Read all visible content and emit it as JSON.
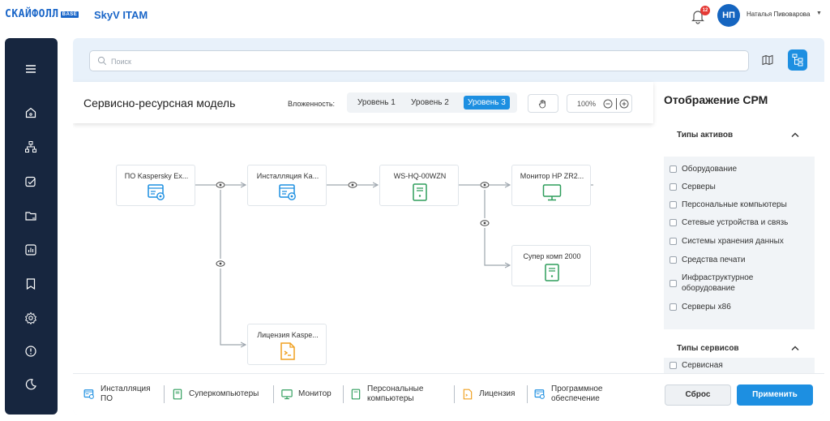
{
  "header": {
    "logo_text": "СКАЙФОЛЛ",
    "logo_badge": "BASE",
    "app_name": "SkyV ITAM",
    "notifications_count": "12",
    "avatar_initials": "НП",
    "user_name": "Наталья Пивоварова"
  },
  "sidebar": {
    "items": [
      "menu-icon",
      "home-icon",
      "structure-icon",
      "checklist-icon",
      "folder-icon",
      "report-icon",
      "bookmark-icon",
      "settings-icon",
      "info-icon",
      "moon-icon"
    ]
  },
  "search": {
    "placeholder": "Поиск"
  },
  "canvas": {
    "title": "Сервисно-ресурсная модель",
    "nesting_label": "Вложенность:",
    "levels": [
      "Уровень 1",
      "Уровень 2",
      "Уровень 3"
    ],
    "active_level": "Уровень 3",
    "zoom": "100%"
  },
  "nodes": [
    {
      "label": "ПО Kaspersky Ex...",
      "icon": "software-icon",
      "color": "#1d8fe1"
    },
    {
      "label": "Инсталляция Ka...",
      "icon": "installation-icon",
      "color": "#1d8fe1"
    },
    {
      "label": "WS-HQ-00WZN",
      "icon": "supercomputer-icon",
      "color": "#2e9d5b"
    },
    {
      "label": "Монитор HP ZR2...",
      "icon": "monitor-icon",
      "color": "#2e9d5b"
    },
    {
      "label": "Супер комп 2000",
      "icon": "supercomputer-icon",
      "color": "#2e9d5b"
    },
    {
      "label": "Лицензия Kaspe...",
      "icon": "license-icon",
      "color": "#f0a020"
    }
  ],
  "legend": [
    {
      "label": "Инсталляция\nПО",
      "icon": "installation-icon"
    },
    {
      "label": "Суперкомпьютеры",
      "icon": "supercomputer-icon"
    },
    {
      "label": "Монитор",
      "icon": "monitor-icon"
    },
    {
      "label": "Персональные\nкомпьютеры",
      "icon": "pc-icon"
    },
    {
      "label": "Лицензия",
      "icon": "license-icon"
    },
    {
      "label": "Программное\nобеспечение",
      "icon": "software-icon"
    }
  ],
  "right_panel": {
    "title": "Отображение СРМ",
    "asset_types_label": "Типы активов",
    "asset_types": [
      "Оборудование",
      "Серверы",
      "Персональные компьютеры",
      "Сетевые устройства и связь",
      "Системы хранения данных",
      "Средства печати",
      "Инфраструктурное\nоборудование",
      "Серверы x86"
    ],
    "service_types_label": "Типы сервисов",
    "service_types": [
      "Сервисная"
    ],
    "reset_label": "Сброс",
    "apply_label": "Применить"
  }
}
